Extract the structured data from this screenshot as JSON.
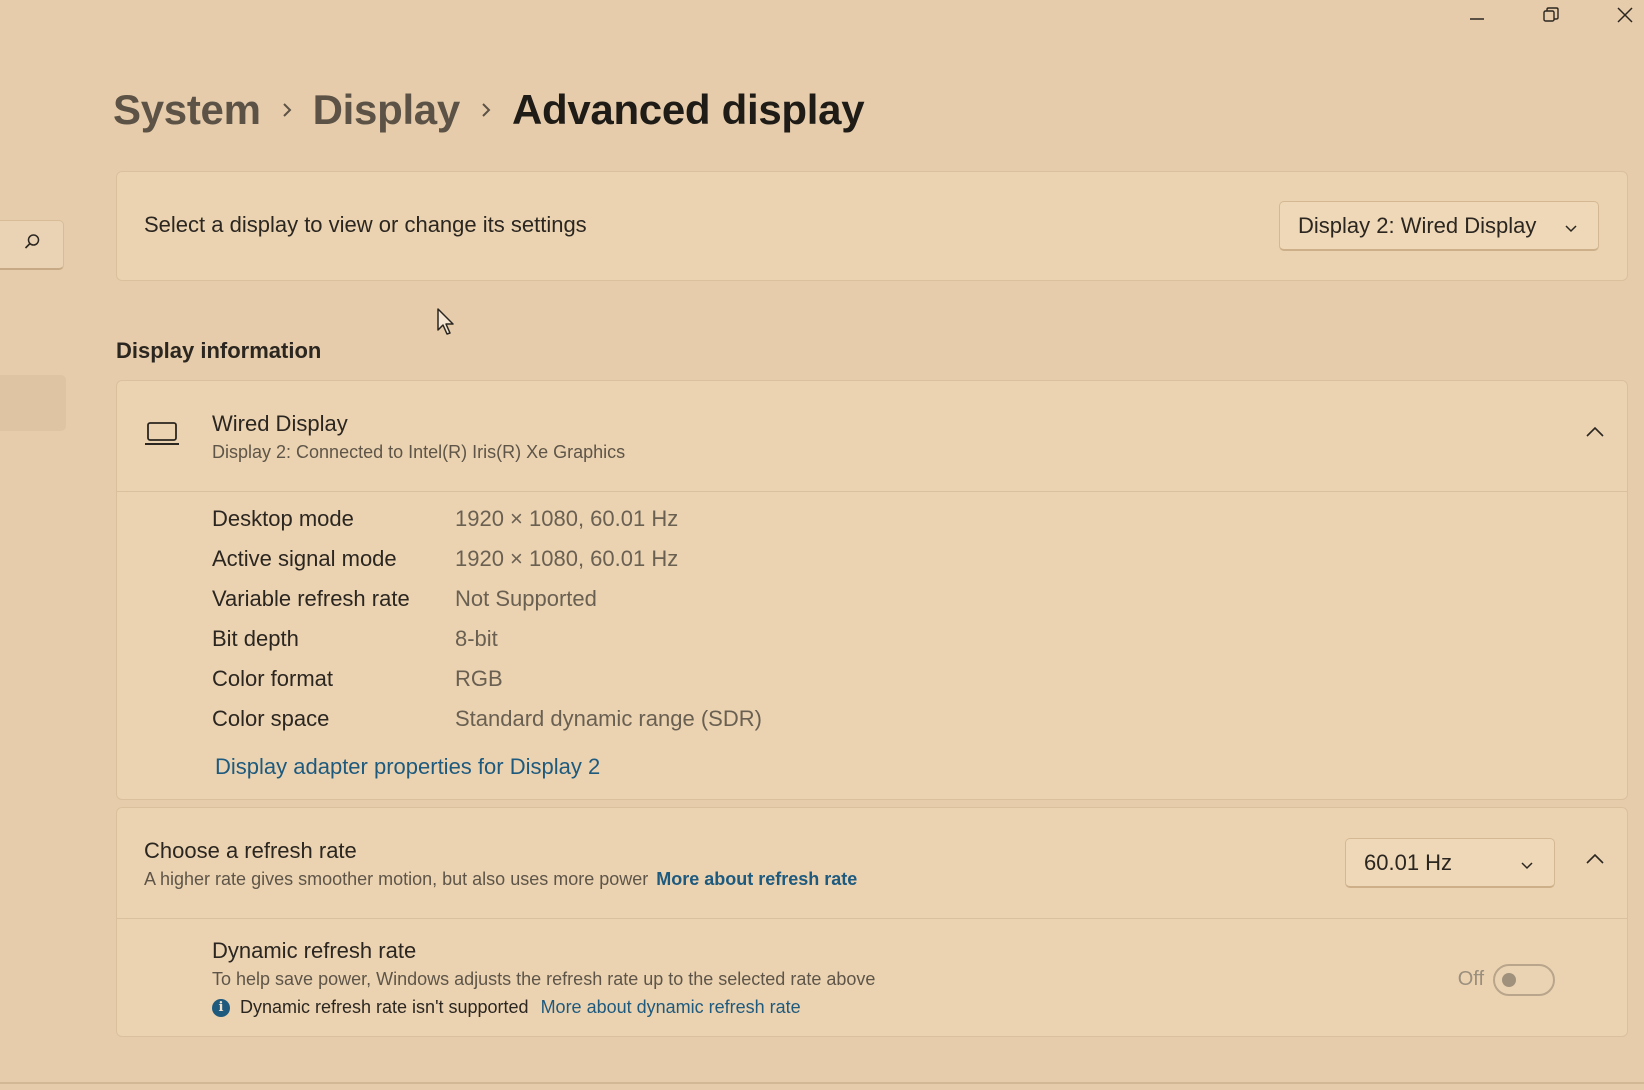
{
  "breadcrumb": {
    "items": [
      "System",
      "Display",
      "Advanced display"
    ]
  },
  "select_display": {
    "label": "Select a display to view or change its settings",
    "dropdown_value": "Display 2: Wired Display"
  },
  "display_information": {
    "section_title": "Display information",
    "name": "Wired Display",
    "connection": "Display 2: Connected to Intel(R) Iris(R) Xe Graphics",
    "properties": [
      {
        "label": "Desktop mode",
        "value": "1920 × 1080, 60.01 Hz"
      },
      {
        "label": "Active signal mode",
        "value": "1920 × 1080, 60.01 Hz"
      },
      {
        "label": "Variable refresh rate",
        "value": "Not Supported"
      },
      {
        "label": "Bit depth",
        "value": "8-bit"
      },
      {
        "label": "Color format",
        "value": "RGB"
      },
      {
        "label": "Color space",
        "value": "Standard dynamic range (SDR)"
      }
    ],
    "adapter_link": "Display adapter properties for Display 2"
  },
  "refresh_rate": {
    "title": "Choose a refresh rate",
    "subtitle": "A higher rate gives smoother motion, but also uses more power",
    "more_link": "More about refresh rate",
    "selected": "60.01 Hz"
  },
  "dynamic_refresh": {
    "title": "Dynamic refresh rate",
    "subtitle": "To help save power, Windows adjusts the refresh rate up to the selected rate above",
    "note": "Dynamic refresh rate isn't supported",
    "more_link": "More about dynamic refresh rate",
    "toggle_state": "Off"
  },
  "icons": {
    "window_controls": [
      "minimize-icon",
      "restore-icon",
      "close-icon"
    ],
    "nav": "search-icon",
    "display": "laptop-icon"
  },
  "colors": {
    "accent_link": "#1e5a7e",
    "background": "#e6ccab",
    "card": "#ebd3b2"
  }
}
